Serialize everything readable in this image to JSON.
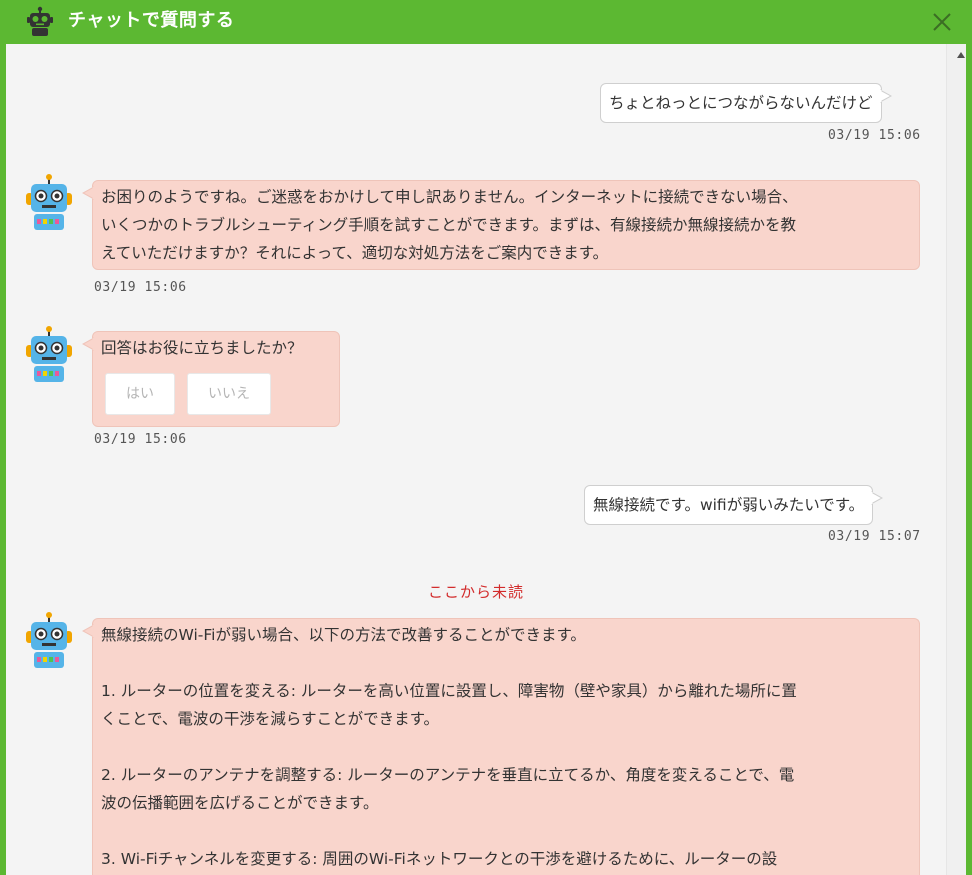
{
  "header": {
    "title": "チャットで質問する",
    "accent_color": "#5cb832"
  },
  "messages": {
    "user1": {
      "text": "ちょとねっとにつながらないんだけど",
      "time": "03/19 15:06"
    },
    "bot1": {
      "lines": [
        "お困りのようですね。ご迷惑をおかけして申し訳ありません。インターネットに接続できない場合、",
        "いくつかのトラブルシューティング手順を試すことができます。まずは、有線接続か無線接続かを教",
        "えていただけますか？それによって、適切な対処方法をご案内できます。"
      ],
      "time": "03/19 15:06"
    },
    "bot2": {
      "text": "回答はお役に立ちましたか？",
      "yes_label": "はい",
      "no_label": "いいえ",
      "time": "03/19 15:06"
    },
    "user2": {
      "text": "無線接続です。wifiが弱いみたいです。",
      "time": "03/19 15:07"
    },
    "unread_marker": "ここから未読",
    "bot3": {
      "intro": "無線接続のWi-Fiが弱い場合、以下の方法で改善することができます。",
      "item1": [
        "1. ルーターの位置を変える: ルーターを高い位置に設置し、障害物（壁や家具）から離れた場所に置",
        "くことで、電波の干渉を減らすことができます。"
      ],
      "item2": [
        "2. ルーターのアンテナを調整する: ルーターのアンテナを垂直に立てるか、角度を変えることで、電",
        "波の伝播範囲を広げることができます。"
      ],
      "item3": [
        "3. Wi-Fiチャンネルを変更する: 周囲のWi-Fiネットワークとの干渉を避けるために、ルーターの設"
      ]
    }
  },
  "colors": {
    "bot_bubble": "#f9d5cc",
    "user_bubble": "#ffffff",
    "unread": "#d22b2b"
  }
}
